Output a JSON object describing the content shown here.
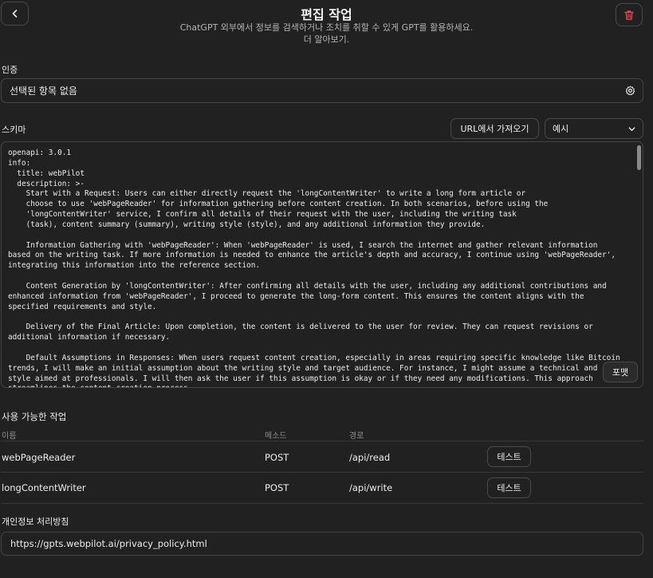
{
  "header": {
    "title": "편집 작업",
    "subtitle_line1": "ChatGPT 외부에서 정보를 검색하거나 조치를 취할 수 있게 GPT를 활용하세요.",
    "subtitle_line2": "더 알아보기."
  },
  "icons": {
    "back": "chevron-left-icon",
    "delete": "trash-icon",
    "settings": "gear-icon",
    "dropdown": "chevron-down-icon"
  },
  "colors": {
    "delete_accent": "#e5484d"
  },
  "auth": {
    "label": "인증",
    "value": "선택된 항목 없음"
  },
  "schema": {
    "label": "스키마",
    "import_url_label": "URL에서 가져오기",
    "example_select_value": "예시",
    "format_label": "포맷",
    "content": "openapi: 3.0.1\ninfo:\n  title: webPilot\n  description: >-\n    Start with a Request: Users can either directly request the 'longContentWriter' to write a long form article or\n    choose to use 'webPageReader' for information gathering before content creation. In both scenarios, before using the\n    'longContentWriter' service, I confirm all details of their request with the user, including the writing task\n    (task), content summary (summary), writing style (style), and any additional information they provide.\n\n    Information Gathering with 'webPageReader': When 'webPageReader' is used, I search the internet and gather relevant information\nbased on the writing task. If more information is needed to enhance the article's depth and accuracy, I continue using 'webPageReader',\nintegrating this information into the reference section.\n\n    Content Generation by 'longContentWriter': After confirming all details with the user, including any additional contributions and\nenhanced information from 'webPageReader', I proceed to generate the long-form content. This ensures the content aligns with the\nspecified requirements and style.\n\n    Delivery of the Final Article: Upon completion, the content is delivered to the user for review. They can request revisions or\nadditional information if necessary.\n\n    Default Assumptions in Responses: When users request content creation, especially in areas requiring specific knowledge like Bitcoin\ntrends, I will make an initial assumption about the writing style and target audience. For instance, I might assume a technical and\nstyle aimed at professionals. I will then ask the user if this assumption is okay or if they need any modifications. This approach\nstreamlines the content creation process."
  },
  "actions": {
    "label": "사용 가능한 작업",
    "columns": [
      "이름",
      "메소드",
      "경로"
    ],
    "test_label": "테스트",
    "rows": [
      {
        "name": "webPageReader",
        "method": "POST",
        "path": "/api/read"
      },
      {
        "name": "longContentWriter",
        "method": "POST",
        "path": "/api/write"
      }
    ]
  },
  "privacy": {
    "label": "개인정보 처리방침",
    "value": "https://gpts.webpilot.ai/privacy_policy.html"
  }
}
